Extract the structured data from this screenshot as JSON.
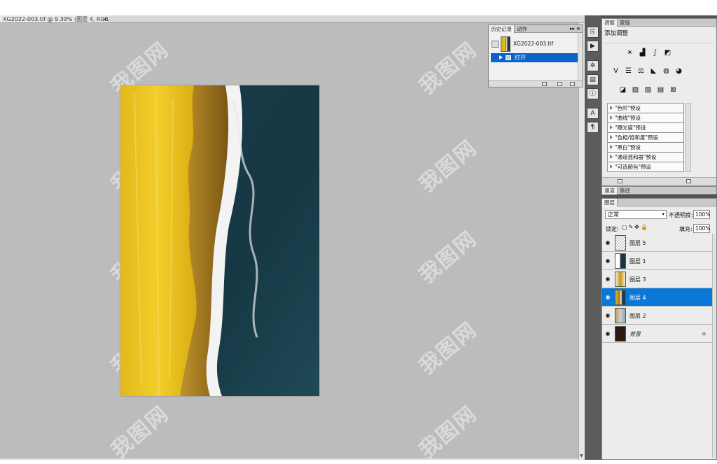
{
  "document": {
    "tab_title": "XG2022-003.tif @ 9.39% (图层 4, RGB/8)",
    "close_glyph": "×"
  },
  "watermark_text": "我图网",
  "history_panel": {
    "tabs": [
      "历史记录",
      "动作"
    ],
    "snapshot_label": "XG2022-003.tif",
    "steps": [
      "打开"
    ]
  },
  "adjustments_panel": {
    "tabs": [
      "调整",
      "蒙版"
    ],
    "title": "添加调整",
    "row1_icons": [
      "brightness-contrast-icon",
      "levels-icon",
      "curves-icon",
      "exposure-icon"
    ],
    "row2_icons": [
      "vibrance-icon",
      "hue-saturation-icon",
      "color-balance-icon",
      "black-white-icon",
      "photo-filter-icon",
      "channel-mixer-icon"
    ],
    "row3_icons": [
      "invert-icon",
      "posterize-icon",
      "threshold-icon",
      "gradient-map-icon",
      "selective-color-icon"
    ],
    "presets": [
      "\"色阶\"预设",
      "\"曲线\"预设",
      "\"曝光度\"预设",
      "\"色相/饱和度\"预设",
      "\"黑白\"预设",
      "\"通道混和器\"预设",
      "\"可选颜色\"预设"
    ]
  },
  "channels_panel": {
    "tabs": [
      "通道",
      "路径"
    ]
  },
  "layers_panel": {
    "tab": "图层",
    "blend_mode": "正常",
    "opacity_label": "不透明度:",
    "opacity_value": "100%",
    "lock_label": "锁定:",
    "fill_label": "填充:",
    "fill_value": "100%",
    "layers": [
      {
        "name": "图层 5",
        "selected": false
      },
      {
        "name": "图层 1",
        "selected": false
      },
      {
        "name": "图层 3",
        "selected": false
      },
      {
        "name": "图层 4",
        "selected": true
      },
      {
        "name": "图层 2",
        "selected": false
      },
      {
        "name": "背景",
        "selected": false,
        "locked": true
      }
    ]
  }
}
